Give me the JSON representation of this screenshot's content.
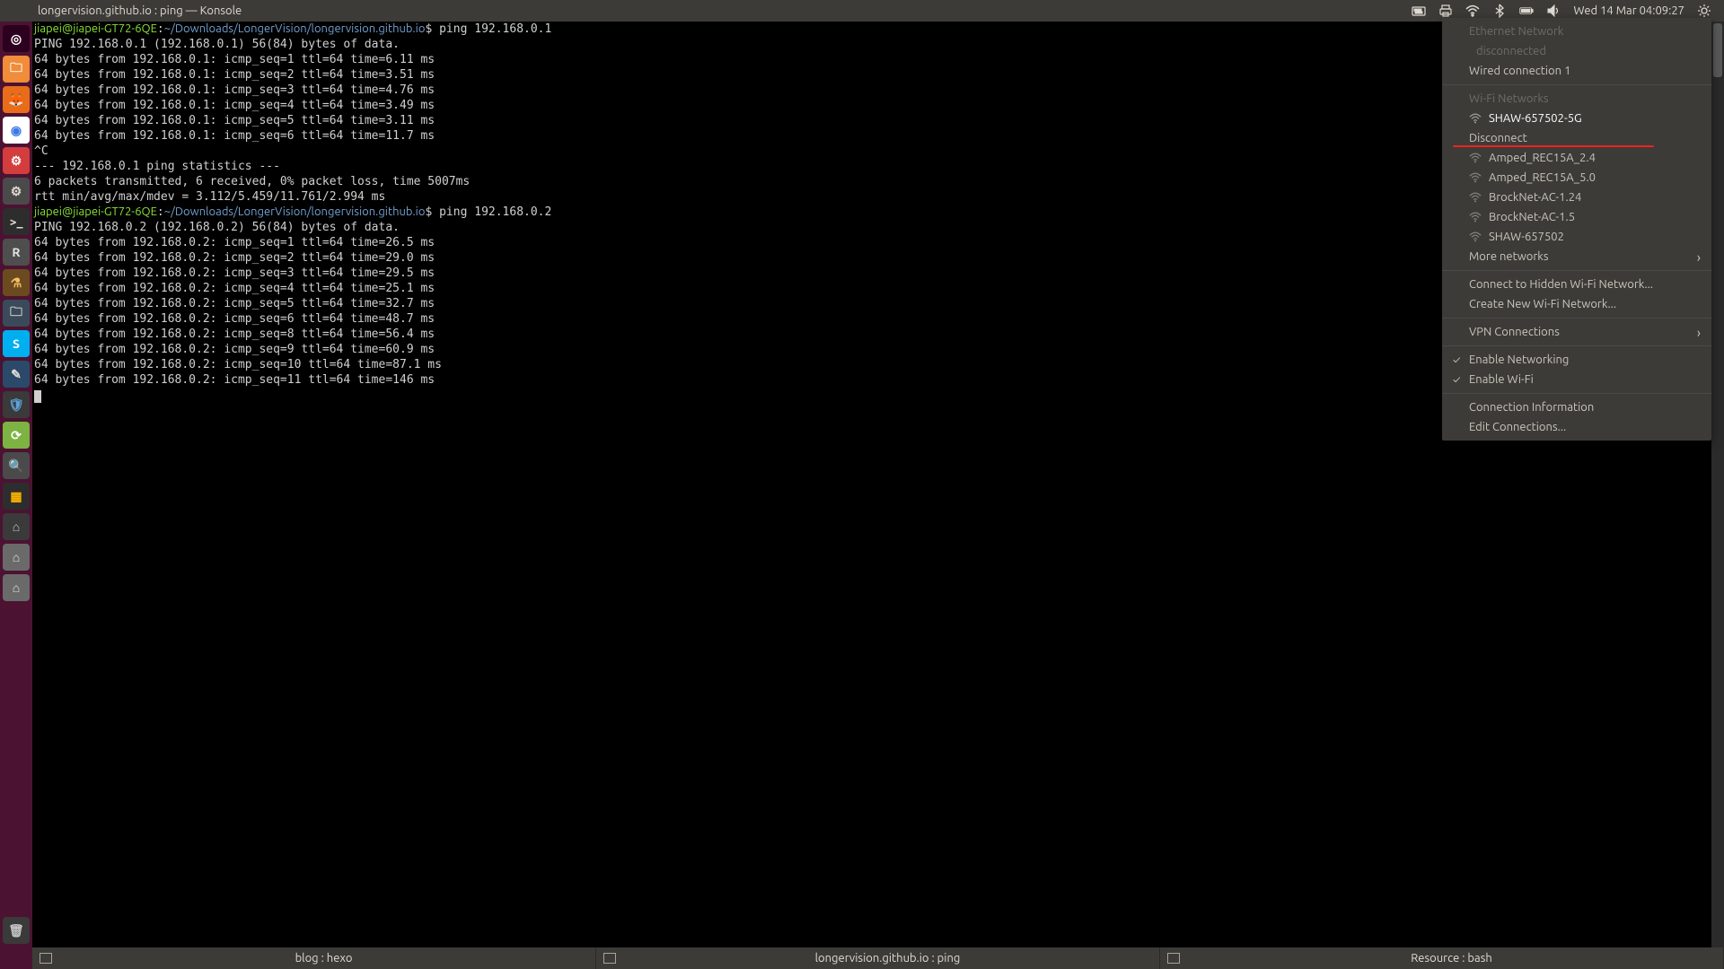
{
  "top": {
    "title": "longervision.github.io : ping — Konsole",
    "clock": "Wed 14 Mar 04:09:27"
  },
  "launcher": {
    "items": [
      {
        "name": "dash",
        "bg": "#2c001e",
        "fg": "#ffffff",
        "glyph": "◎"
      },
      {
        "name": "files",
        "bg": "#f08c3a",
        "fg": "#ffffff",
        "glyph": "🗀"
      },
      {
        "name": "firefox",
        "bg": "#e86c1a",
        "fg": "#ffffff",
        "glyph": "🦊"
      },
      {
        "name": "chromium",
        "bg": "#ffffff",
        "fg": "#3b78e7",
        "glyph": "◉"
      },
      {
        "name": "jenkins",
        "bg": "#d33d3d",
        "fg": "#ffffff",
        "glyph": "⚙"
      },
      {
        "name": "settings",
        "bg": "#4a4a4a",
        "fg": "#dfdbd2",
        "glyph": "⚙"
      },
      {
        "name": "terminal",
        "bg": "#2d2d2d",
        "fg": "#dfdbd2",
        "glyph": ">_"
      },
      {
        "name": "kate",
        "bg": "#4e4e4e",
        "fg": "#e3e3e3",
        "glyph": "R"
      },
      {
        "name": "lab",
        "bg": "#6c4a1f",
        "fg": "#f0c060",
        "glyph": "⚗"
      },
      {
        "name": "dolphin",
        "bg": "#3a4a5a",
        "fg": "#dfdbd2",
        "glyph": "🗀"
      },
      {
        "name": "skype",
        "bg": "#00aff0",
        "fg": "#ffffff",
        "glyph": "S"
      },
      {
        "name": "editor",
        "bg": "#2b4a6a",
        "fg": "#dfdbd2",
        "glyph": "✎"
      },
      {
        "name": "shield",
        "bg": "#3a3a3a",
        "fg": "#5ea1d8",
        "glyph": "🛡"
      },
      {
        "name": "sync",
        "bg": "#7cb342",
        "fg": "#ffffff",
        "glyph": "⟳"
      },
      {
        "name": "search",
        "bg": "#4a4a4a",
        "fg": "#9ccc65",
        "glyph": "🔍"
      },
      {
        "name": "grid",
        "bg": "#2d2d2d",
        "fg": "#ffb300",
        "glyph": "▦"
      },
      {
        "name": "device1",
        "bg": "#3a3a3a",
        "fg": "#c5c5c5",
        "glyph": "⌂"
      },
      {
        "name": "device2",
        "bg": "#6a6a6a",
        "fg": "#e0e0e0",
        "glyph": "⌂"
      },
      {
        "name": "device3",
        "bg": "#6a6a6a",
        "fg": "#e0e0e0",
        "glyph": "⌂"
      }
    ],
    "trash_glyph": "🗑"
  },
  "terminal": {
    "prompt_user": "jiapei@jiapei-GT72-6QE",
    "prompt_path": "~/Downloads/LongerVision/longervision.github.io",
    "cmd1": "ping 192.168.0.1",
    "cmd2": "ping 192.168.0.2",
    "lines1": [
      "PING 192.168.0.1 (192.168.0.1) 56(84) bytes of data.",
      "64 bytes from 192.168.0.1: icmp_seq=1 ttl=64 time=6.11 ms",
      "64 bytes from 192.168.0.1: icmp_seq=2 ttl=64 time=3.51 ms",
      "64 bytes from 192.168.0.1: icmp_seq=3 ttl=64 time=4.76 ms",
      "64 bytes from 192.168.0.1: icmp_seq=4 ttl=64 time=3.49 ms",
      "64 bytes from 192.168.0.1: icmp_seq=5 ttl=64 time=3.11 ms",
      "64 bytes from 192.168.0.1: icmp_seq=6 ttl=64 time=11.7 ms",
      "^C",
      "--- 192.168.0.1 ping statistics ---",
      "6 packets transmitted, 6 received, 0% packet loss, time 5007ms",
      "rtt min/avg/max/mdev = 3.112/5.459/11.761/2.994 ms"
    ],
    "lines2": [
      "PING 192.168.0.2 (192.168.0.2) 56(84) bytes of data.",
      "64 bytes from 192.168.0.2: icmp_seq=1 ttl=64 time=26.5 ms",
      "64 bytes from 192.168.0.2: icmp_seq=2 ttl=64 time=29.0 ms",
      "64 bytes from 192.168.0.2: icmp_seq=3 ttl=64 time=29.5 ms",
      "64 bytes from 192.168.0.2: icmp_seq=4 ttl=64 time=25.1 ms",
      "64 bytes from 192.168.0.2: icmp_seq=5 ttl=64 time=32.7 ms",
      "64 bytes from 192.168.0.2: icmp_seq=6 ttl=64 time=48.7 ms",
      "64 bytes from 192.168.0.2: icmp_seq=8 ttl=64 time=56.4 ms",
      "64 bytes from 192.168.0.2: icmp_seq=9 ttl=64 time=60.9 ms",
      "64 bytes from 192.168.0.2: icmp_seq=10 ttl=64 time=87.1 ms",
      "64 bytes from 192.168.0.2: icmp_seq=11 ttl=64 time=146 ms"
    ]
  },
  "network_menu": {
    "ethernet_header": "Ethernet Network",
    "ethernet_status": "disconnected",
    "wired": "Wired connection 1",
    "wifi_header": "Wi-Fi Networks",
    "connected": "SHAW-657502-5G",
    "disconnect": "Disconnect",
    "networks": [
      "Amped_REC15A_2.4",
      "Amped_REC15A_5.0",
      "BrockNet-AC-1.24",
      "BrockNet-AC-1.5",
      "SHAW-657502"
    ],
    "more": "More networks",
    "hidden": "Connect to Hidden Wi-Fi Network...",
    "create": "Create New Wi-Fi Network...",
    "vpn": "VPN Connections",
    "en_net": "Enable Networking",
    "en_wifi": "Enable Wi-Fi",
    "conn_info": "Connection Information",
    "edit": "Edit Connections..."
  },
  "taskbar": {
    "tasks": [
      "blog : hexo",
      "longervision.github.io : ping",
      "Resource : bash"
    ]
  }
}
